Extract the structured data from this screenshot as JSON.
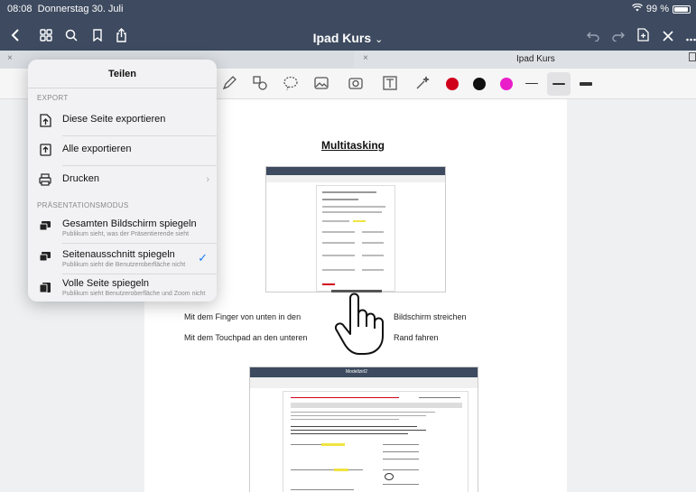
{
  "status": {
    "time": "08:08",
    "date": "Donnerstag 30. Juli",
    "battery": "99 %"
  },
  "nav": {
    "title": "Ipad Kurs",
    "title_chevron": "⌄"
  },
  "tabs": {
    "active_label": "Ipad Kurs",
    "close_glyph": "×"
  },
  "toolbar": {
    "colors": [
      "#d0021b",
      "#111111",
      "#e91ec9"
    ]
  },
  "content": {
    "heading": "Multitasking",
    "caption_left_1": "Mit dem Finger von unten in den",
    "caption_right_1": "Bildschirm streichen",
    "caption_left_2": "Mit dem Touchpad an den unteren",
    "caption_right_2": "Rand fahren",
    "shot_title": "Modellzirl2"
  },
  "share": {
    "title": "Teilen",
    "export_header": "EXPORT",
    "items": [
      {
        "label": "Diese Seite exportieren"
      },
      {
        "label": "Alle exportieren"
      },
      {
        "label": "Drucken"
      }
    ],
    "presentation_header": "PRÄSENTATIONSMODUS",
    "modes": [
      {
        "label": "Gesamten Bildschirm spiegeln",
        "sub": "Publikum sieht, was der Präsentierende sieht"
      },
      {
        "label": "Seitenausschnitt spiegeln",
        "sub": "Publikum sieht die Benutzeroberfläche nicht",
        "selected": true
      },
      {
        "label": "Volle Seite spiegeln",
        "sub": "Publikum sieht Benutzeroberfläche und Zoom nicht"
      }
    ],
    "check": "✓",
    "chevron": "›"
  }
}
